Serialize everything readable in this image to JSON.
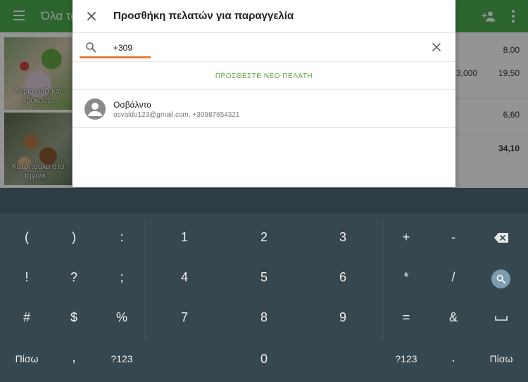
{
  "background": {
    "title": "Όλα τα",
    "tiles": [
      {
        "caption": "Άγριο ρύζι και αβοκάντο"
      },
      {
        "caption": "Κοτόπουλο στο τηγάνι..."
      }
    ],
    "rows": [
      {
        "value": "8,00"
      },
      {
        "qty": "3,000",
        "value": "19,50"
      },
      {
        "value": "6,60"
      },
      {
        "value": "34,10"
      }
    ]
  },
  "dialog": {
    "title": "Προσθήκη πελατών για παραγγελία",
    "search": {
      "value": "+309"
    },
    "add_customer_label": "ΠΡΟΣΘΕΣΤΕ ΝΕΟ ΠΕΛΑΤΗ",
    "customers": [
      {
        "name": "Οσβάλντο",
        "details": "osvaldo123@gmail.com, +30987654321"
      }
    ]
  },
  "keyboard": {
    "row1": [
      "(",
      ")",
      ":",
      "1",
      "2",
      "3",
      "+",
      "-"
    ],
    "row2": [
      "!",
      "?",
      ";",
      "4",
      "5",
      "6",
      "*",
      "/"
    ],
    "row3": [
      "#",
      "$",
      "%",
      "7",
      "8",
      "9",
      "=",
      "&"
    ],
    "row4": [
      "Πίσω",
      ",",
      "?123",
      "0",
      "?123",
      ".",
      "Πίσω"
    ]
  },
  "colors": {
    "accent_green": "#5aa63a",
    "toolbar_green": "#4caf50",
    "search_underline": "#e57c3a",
    "keyboard_bg": "#37474f"
  }
}
